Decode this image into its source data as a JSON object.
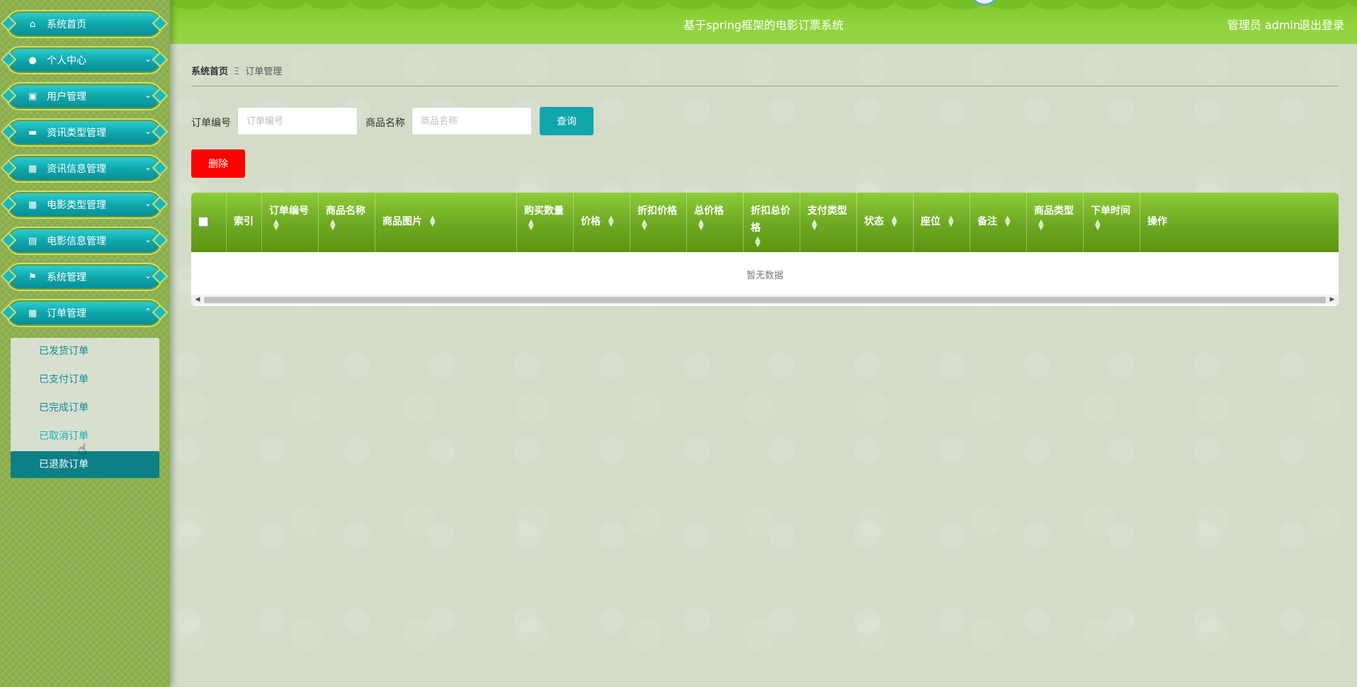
{
  "header": {
    "title": "基于spring框架的电影订票系统",
    "admin_label": "管理员 admin",
    "logout_label": "退出登录"
  },
  "sidebar": {
    "items": [
      {
        "label": "系统首页",
        "icon": "home-icon"
      },
      {
        "label": "个人中心",
        "icon": "user-icon"
      },
      {
        "label": "用户管理",
        "icon": "briefcase-icon"
      },
      {
        "label": "资讯类型管理",
        "icon": "monitor-icon"
      },
      {
        "label": "资讯信息管理",
        "icon": "grid-icon"
      },
      {
        "label": "电影类型管理",
        "icon": "grid-icon"
      },
      {
        "label": "电影信息管理",
        "icon": "clipboard-icon"
      },
      {
        "label": "系统管理",
        "icon": "flag-icon"
      },
      {
        "label": "订单管理",
        "icon": "grid-icon"
      }
    ],
    "submenu": [
      {
        "label": "已发货订单"
      },
      {
        "label": "已支付订单"
      },
      {
        "label": "已完成订单"
      },
      {
        "label": "已取消订单"
      },
      {
        "label": "已退款订单",
        "active": true
      }
    ]
  },
  "breadcrumb": {
    "home": "系统首页",
    "separator": "Ξ",
    "current": "订单管理"
  },
  "search": {
    "order_no_label": "订单编号",
    "order_no_placeholder": "订单编号",
    "product_name_label": "商品名称",
    "product_name_placeholder": "商品名称",
    "query_label": "查询",
    "delete_label": "删除"
  },
  "table": {
    "columns": [
      {
        "label": "索引"
      },
      {
        "label": "订单编号"
      },
      {
        "label": "商品名称"
      },
      {
        "label": "商品图片"
      },
      {
        "label": "购买数量"
      },
      {
        "label": "价格"
      },
      {
        "label": "折扣价格"
      },
      {
        "label": "总价格"
      },
      {
        "label": "折扣总价格"
      },
      {
        "label": "支付类型"
      },
      {
        "label": "状态"
      },
      {
        "label": "座位"
      },
      {
        "label": "备注"
      },
      {
        "label": "商品类型"
      },
      {
        "label": "下单时间"
      },
      {
        "label": "操作"
      }
    ],
    "empty_text": "暂无数据"
  },
  "colors": {
    "accent_teal": "#11a5ac",
    "header_green": "#8fd33b",
    "delete_red": "#ff0000"
  }
}
